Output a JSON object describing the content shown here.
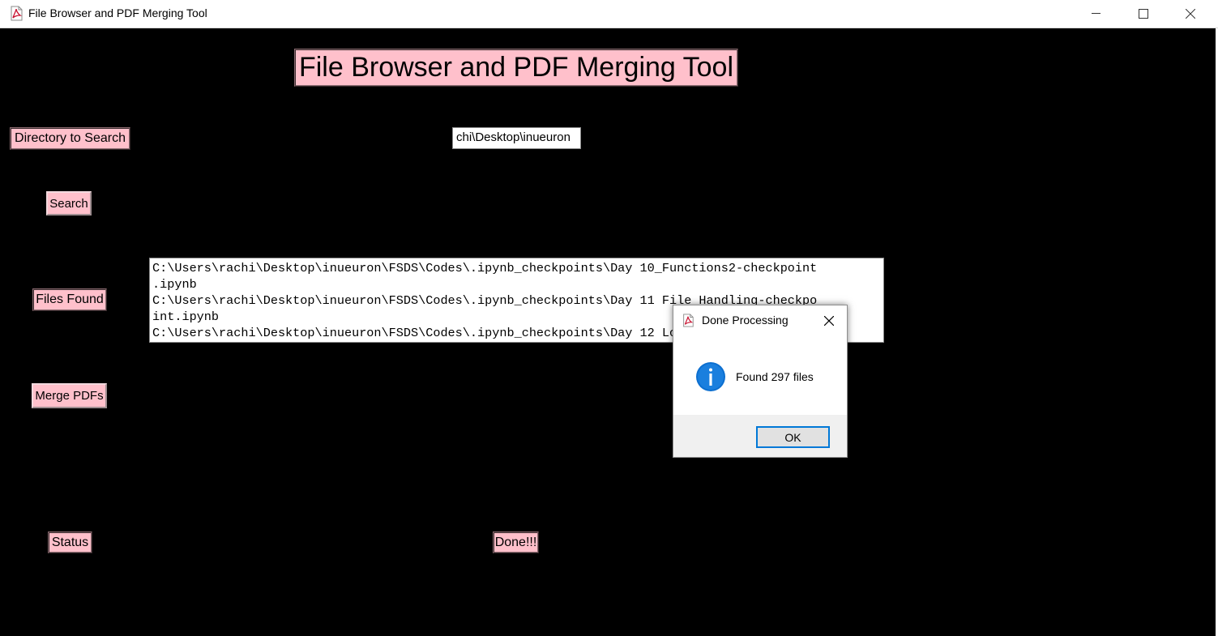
{
  "window": {
    "title": "File Browser and PDF Merging Tool",
    "icon": "pdf-app-icon",
    "controls": [
      "minimize-icon",
      "maximize-icon",
      "close-icon"
    ]
  },
  "app": {
    "heading": "File Browser and PDF Merging Tool",
    "directory_label": "Directory to Search",
    "directory_value": "chi\\Desktop\\inueuron",
    "search_button": "Search",
    "files_found_label": "Files Found",
    "files_lines": [
      "C:\\Users\\rachi\\Desktop\\inueuron\\FSDS\\Codes\\.ipynb_checkpoints\\Day 10_Functions2-checkpoint",
      ".ipynb",
      "C:\\Users\\rachi\\Desktop\\inueuron\\FSDS\\Codes\\.ipynb_checkpoints\\Day 11 File Handling-checkpo",
      "int.ipynb",
      "C:\\Users\\rachi\\Desktop\\inueuron\\FSDS\\Codes\\.ipynb_checkpoints\\Day 12 Logging_an"
    ],
    "merge_button": "Merge PDFs",
    "status_label": "Status",
    "status_value": "Done!!!"
  },
  "dialog": {
    "title": "Done Processing",
    "icon": "info-icon",
    "message": "Found 297 files",
    "ok_label": "OK"
  },
  "colors": {
    "background": "#000000",
    "label_bg": "#ffc0cb",
    "accent": "#0078d7"
  }
}
